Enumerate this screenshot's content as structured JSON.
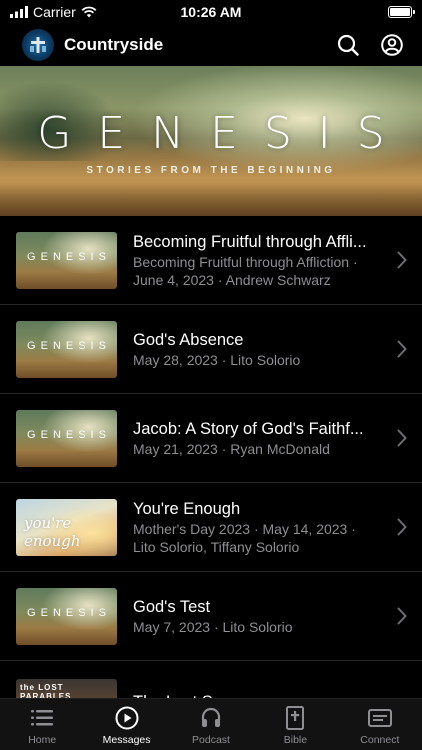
{
  "status_bar": {
    "carrier": "Carrier",
    "time": "10:26 AM"
  },
  "header": {
    "title": "Countryside",
    "logo_icon": "church-logo-icon",
    "search_icon": "search-icon",
    "account_icon": "account-icon"
  },
  "hero": {
    "title": "GENESIS",
    "subtitle": "STORIES FROM THE BEGINNING"
  },
  "messages": [
    {
      "title": "Becoming Fruitful through Affli...",
      "series": "Becoming Fruitful through Affliction ·",
      "meta": "June 4, 2023 · Andrew Schwarz",
      "thumb": "GENESIS"
    },
    {
      "title": "God's Absence",
      "series": "",
      "meta": "May 28, 2023 · Lito Solorio",
      "thumb": "GENESIS"
    },
    {
      "title": "Jacob: A Story of God's Faithf...",
      "series": "",
      "meta": "May 21, 2023 · Ryan McDonald",
      "thumb": "GENESIS"
    },
    {
      "title": "You're Enough",
      "series": "Mother's Day 2023 · May 14, 2023 ·",
      "meta": "Lito Solorio, Tiffany Solorio",
      "thumb": "you're enough"
    },
    {
      "title": "God's Test",
      "series": "",
      "meta": "May 7, 2023 · Lito Solorio",
      "thumb": "GENESIS"
    },
    {
      "title": "The Lost Son",
      "series": "",
      "meta": "",
      "thumb": "the LOST PARABLES"
    }
  ],
  "tabs": [
    {
      "label": "Home",
      "icon": "list-icon",
      "active": false
    },
    {
      "label": "Messages",
      "icon": "play-icon",
      "active": true
    },
    {
      "label": "Podcast",
      "icon": "headphones-icon",
      "active": false
    },
    {
      "label": "Bible",
      "icon": "bible-icon",
      "active": false
    },
    {
      "label": "Connect",
      "icon": "connect-card-icon",
      "active": false
    }
  ]
}
